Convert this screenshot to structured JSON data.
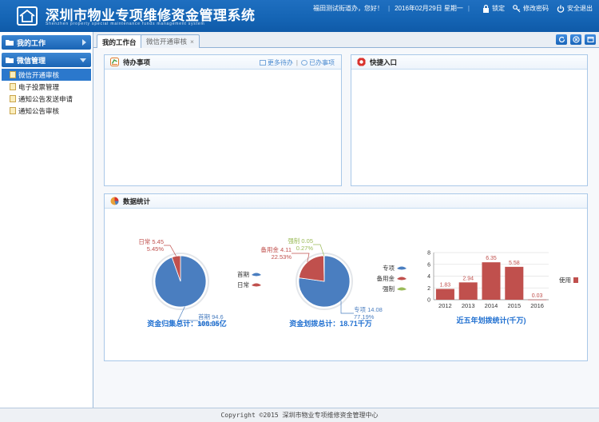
{
  "header": {
    "title": "深圳市物业专项维修资金管理系统",
    "subtitle": "Shenzhen property special maintenance funds management system",
    "greeting": "福田测试街道办，您好！",
    "date": "2016年02月29日 星期一",
    "lock_label": "锁定",
    "password_label": "修改密码",
    "logout_label": "安全退出"
  },
  "sidebar": {
    "sections": [
      {
        "label": "我的工作",
        "expanded": false
      },
      {
        "label": "微信管理",
        "expanded": true
      }
    ],
    "items": [
      {
        "label": "微信开通审核",
        "active": true
      },
      {
        "label": "电子投票管理",
        "active": false
      },
      {
        "label": "通知公告发送申请",
        "active": false
      },
      {
        "label": "通知公告审核",
        "active": false
      }
    ]
  },
  "tabs": [
    {
      "label": "我的工作台",
      "active": true
    },
    {
      "label": "微信开通审核",
      "active": false,
      "close": "×"
    }
  ],
  "panels": {
    "todo": {
      "title": "待办事项",
      "more_label": "更多待办",
      "done_label": "已办事项"
    },
    "quick": {
      "title": "快捷入口"
    },
    "stats": {
      "title": "数据统计"
    }
  },
  "colors": {
    "blue_slice": "#4a7ec0",
    "red_slice": "#c0504d",
    "green_slice": "#9bbb59",
    "bar": "#c0504d",
    "caption": "#1f6fd0"
  },
  "chart_data": [
    {
      "type": "pie",
      "title": "资金归集总计：100.05亿",
      "slices": [
        {
          "name": "首期",
          "value": 94.6,
          "percent": "94.55%",
          "color": "#4a7ec0"
        },
        {
          "name": "日常",
          "value": 5.45,
          "percent": "5.45%",
          "color": "#c0504d"
        }
      ],
      "legend": "right"
    },
    {
      "type": "pie",
      "title": "资金划拨总计：18.71千万",
      "slices": [
        {
          "name": "专项",
          "value": 14.08,
          "percent": "77.19%",
          "color": "#4a7ec0"
        },
        {
          "name": "备用金",
          "value": 4.11,
          "percent": "22.53%",
          "color": "#c0504d"
        },
        {
          "name": "强制",
          "value": 0.05,
          "percent": "0.27%",
          "color": "#9bbb59"
        }
      ],
      "legend": "right"
    },
    {
      "type": "bar",
      "title": "近五年划拨统计(千万)",
      "categories": [
        "2012",
        "2013",
        "2014",
        "2015",
        "2016"
      ],
      "series": [
        {
          "name": "使用",
          "values": [
            1.83,
            2.94,
            6.35,
            5.58,
            0.03
          ]
        }
      ],
      "ylim": [
        0,
        8
      ],
      "yticks": [
        0,
        2,
        4,
        6,
        8
      ],
      "legend": "right",
      "grid": true
    }
  ],
  "footer": {
    "text": "Copyright ©2015 深圳市物业专项维修资金管理中心"
  }
}
